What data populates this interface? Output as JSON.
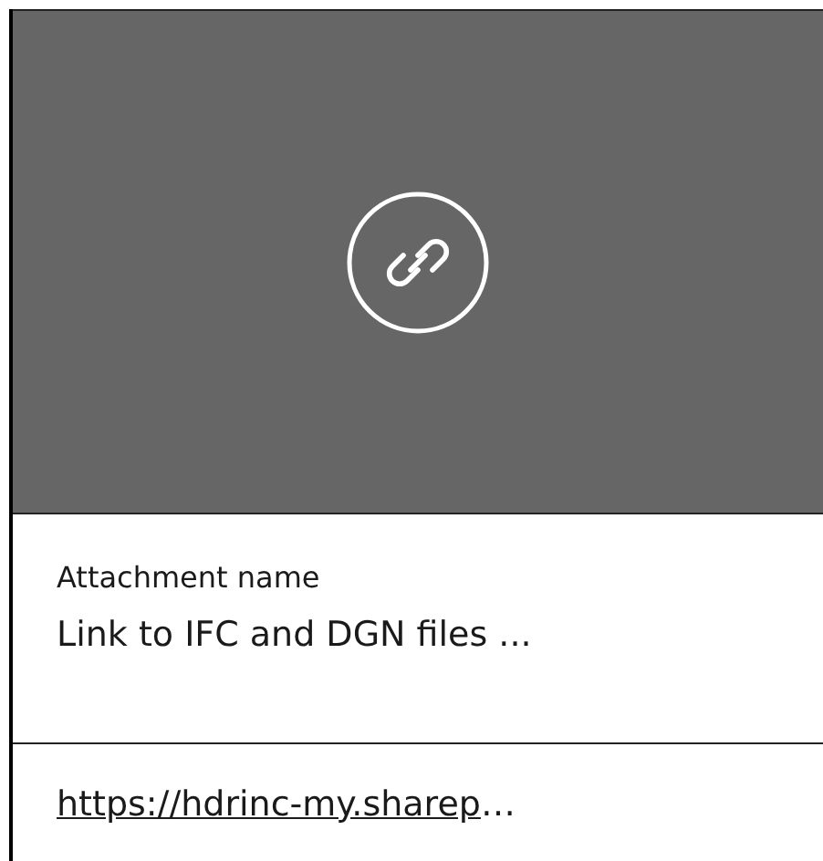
{
  "preview": {
    "kind": "link"
  },
  "attachment": {
    "label": "Attachment name",
    "value": "Link to IFC and DGN files ..."
  },
  "link": {
    "url": "https://hdrinc-my.sharep",
    "ellipsis": "…"
  }
}
